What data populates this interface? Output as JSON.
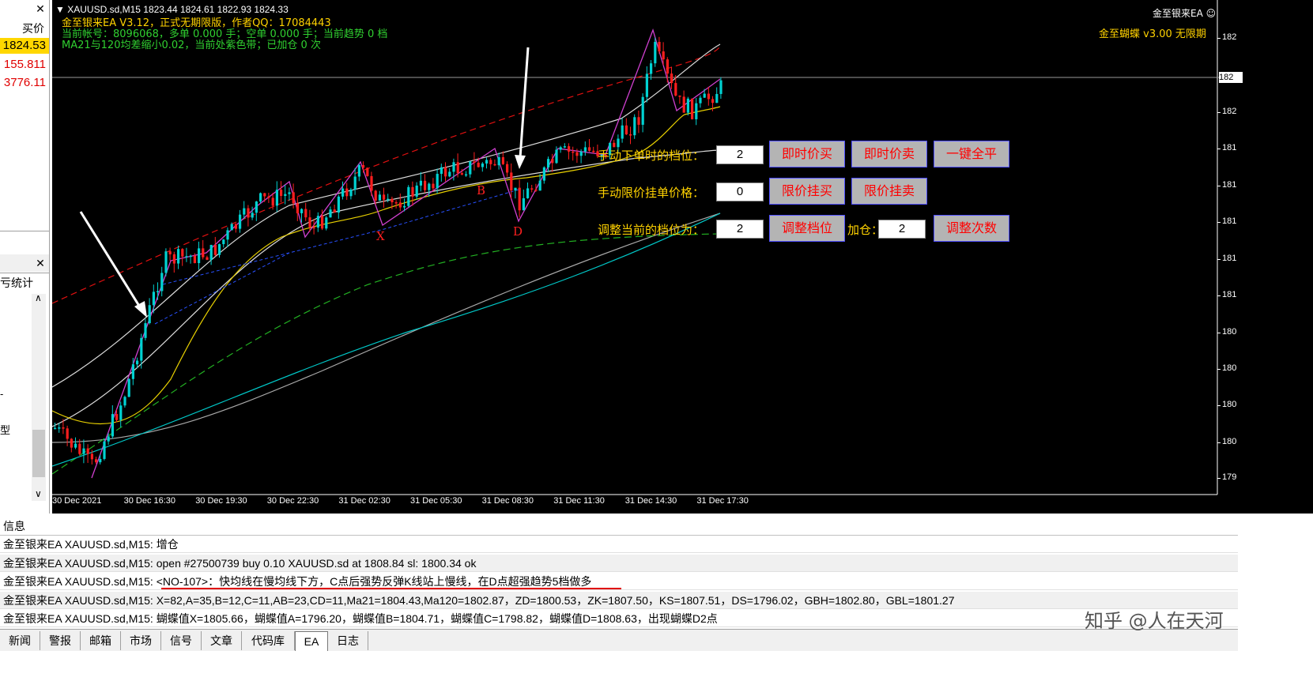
{
  "market_watch": {
    "header": "买价",
    "prices": [
      {
        "value": "1824.53",
        "bg": "#ffd700",
        "color": "#000000"
      },
      {
        "value": "155.811",
        "bg": "#ffffff",
        "color": "#e00000"
      },
      {
        "value": "3776.11",
        "bg": "#ffffff",
        "color": "#e00000"
      }
    ]
  },
  "navigator": {
    "label": "亏统计",
    "mark1": "-",
    "mark2": "型"
  },
  "chart": {
    "symbol_line": "XAUUSD.sd,M15  1823.44 1824.61 1822.93 1824.33",
    "ea_name_top_right": "金至银来EA",
    "ea_version_right": "金至蝴蝶 v3.00 无限期",
    "info_lines": [
      "金至银来EA V3.12，正式无期限版，作者QQ：17084443",
      "当前帐号：8096068，多单 0.000 手；空单 0.000 手；当前趋势 0 档",
      "MA21与120均差缩小0.02，当前处紫色带；已加仓 0 次"
    ],
    "price_axis": [
      "182",
      "182",
      "182",
      "181",
      "181",
      "181",
      "181",
      "181",
      "180",
      "180",
      "180",
      "180",
      "179"
    ],
    "time_axis": [
      "30 Dec 2021",
      "30 Dec 16:30",
      "30 Dec 19:30",
      "30 Dec 22:30",
      "31 Dec 02:30",
      "31 Dec 05:30",
      "31 Dec 08:30",
      "31 Dec 11:30",
      "31 Dec 14:30",
      "31 Dec 17:30"
    ],
    "pattern_labels": [
      "X",
      "B",
      "D"
    ],
    "panel": {
      "row1_label": "手动下单时的档位：",
      "row1_value": "2",
      "btn_buy": "即时价买",
      "btn_sell": "即时价卖",
      "btn_close_all": "一键全平",
      "row2_label": "手动限价挂单价格：",
      "row2_value": "0",
      "btn_limit_buy": "限价挂买",
      "btn_limit_sell": "限价挂卖",
      "row3_label": "调整当前的档位为：",
      "row3_value": "2",
      "btn_adjust_level": "调整档位",
      "add_label": "加仓：",
      "add_value": "2",
      "btn_adjust_count": "调整次数"
    }
  },
  "terminal": {
    "header": "信息",
    "logs": [
      "金至银来EA XAUUSD.sd,M15: 增仓",
      "金至银来EA XAUUSD.sd,M15: open #27500739 buy 0.10 XAUUSD.sd at 1808.84 sl: 1800.34 ok",
      "金至银来EA XAUUSD.sd,M15: <NO-107>：快均线在慢均线下方，C点后强势反弹K线站上慢线，在D点超强趋势5档做多",
      "金至银来EA XAUUSD.sd,M15: X=82,A=35,B=12,C=11,AB=23,CD=11,Ma21=1804.43,Ma120=1802.87，ZD=1800.53，ZK=1807.50，KS=1807.51，DS=1796.02，GBH=1802.80，GBL=1801.27",
      "金至银来EA XAUUSD.sd,M15: 蝴蝶值X=1805.66，蝴蝶值A=1796.20，蝴蝶值B=1804.71，蝴蝶值C=1798.82，蝴蝶值D=1808.63，出现蝴蝶D2点"
    ],
    "tabs": [
      "新闻",
      "警报",
      "邮箱",
      "市场",
      "信号",
      "文章",
      "代码库",
      "EA",
      "日志"
    ],
    "active_tab": "EA"
  },
  "watermark": "知乎 @人在天河"
}
